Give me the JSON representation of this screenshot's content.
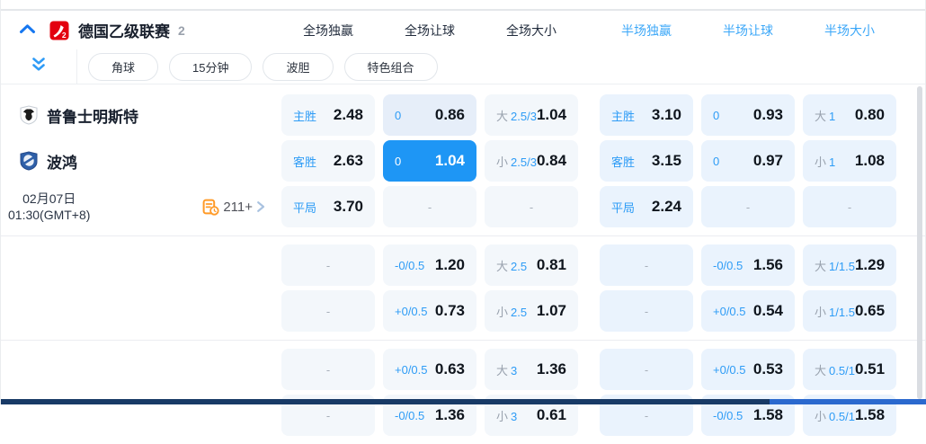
{
  "header": {
    "league_name": "德国乙级联赛",
    "league_count": "2",
    "league_logo_icon": "bundesliga2-logo-icon",
    "collapse_icon": "chevron-up-icon",
    "columns": [
      {
        "label": "全场独赢",
        "half": false
      },
      {
        "label": "全场让球",
        "half": false
      },
      {
        "label": "全场大小",
        "half": false
      },
      {
        "label": "半场独赢",
        "half": true
      },
      {
        "label": "半场让球",
        "half": true
      },
      {
        "label": "半场大小",
        "half": true
      }
    ]
  },
  "subnav": {
    "expand_icon": "double-chevron-down-icon",
    "pills": [
      {
        "label": "角球"
      },
      {
        "label": "15分钟"
      },
      {
        "label": "波胆"
      },
      {
        "label": "特色组合"
      }
    ]
  },
  "match": {
    "home": {
      "name": "普鲁士明斯特",
      "crest_icon": "muenster-eagle-crest-icon"
    },
    "away": {
      "name": "波鸿",
      "crest_icon": "bochum-crest-icon"
    },
    "date": "02月07日",
    "time": "01:30(GMT+8)",
    "more_markets_icon": "markets-clock-icon",
    "more_markets": "211+",
    "more_arrow_icon": "chevron-right-icon"
  },
  "colors": {
    "accent": "#2E9CF6",
    "half_header": "#3BA7F8",
    "selected_cell": "#1E96F5",
    "cell_bg_left": "#F3F7FB",
    "cell_bg_right": "#EAF3FD",
    "bottom_bar": "#183A66",
    "bottom_bar_segment": "#2B69CE",
    "more_icon_orange": "#FF9A27"
  },
  "odds": {
    "groups": [
      {
        "rows": [
          {
            "info": "home",
            "cells": [
              {
                "label": "主胜",
                "value": "2.48"
              },
              {
                "label": "0",
                "value": "0.86",
                "shaded": true
              },
              {
                "pre": "大",
                "label": "2.5/3",
                "value": "1.04"
              },
              {
                "label": "主胜",
                "value": "3.10"
              },
              {
                "label": "0",
                "value": "0.93"
              },
              {
                "pre": "大",
                "label": "1",
                "value": "0.80"
              }
            ]
          },
          {
            "info": "away",
            "cells": [
              {
                "label": "客胜",
                "value": "2.63"
              },
              {
                "label": "0",
                "value": "1.04",
                "selected": true
              },
              {
                "pre": "小",
                "label": "2.5/3",
                "value": "0.84"
              },
              {
                "label": "客胜",
                "value": "3.15"
              },
              {
                "label": "0",
                "value": "0.97"
              },
              {
                "pre": "小",
                "label": "1",
                "value": "1.08"
              }
            ]
          },
          {
            "info": "meta",
            "cells": [
              {
                "label": "平局",
                "value": "3.70"
              },
              {
                "dash": true
              },
              {
                "dash": true
              },
              {
                "label": "平局",
                "value": "2.24"
              },
              {
                "dash": true
              },
              {
                "dash": true
              }
            ]
          }
        ]
      },
      {
        "rows": [
          {
            "cells": [
              {
                "dash": true
              },
              {
                "label": "-0/0.5",
                "value": "1.20"
              },
              {
                "pre": "大",
                "label": "2.5",
                "value": "0.81"
              },
              {
                "dash": true
              },
              {
                "label": "-0/0.5",
                "value": "1.56"
              },
              {
                "pre": "大",
                "label": "1/1.5",
                "value": "1.29"
              }
            ]
          },
          {
            "cells": [
              {
                "dash": true
              },
              {
                "label": "+0/0.5",
                "value": "0.73"
              },
              {
                "pre": "小",
                "label": "2.5",
                "value": "1.07"
              },
              {
                "dash": true
              },
              {
                "label": "+0/0.5",
                "value": "0.54"
              },
              {
                "pre": "小",
                "label": "1/1.5",
                "value": "0.65"
              }
            ]
          }
        ]
      },
      {
        "rows": [
          {
            "cells": [
              {
                "dash": true
              },
              {
                "label": "+0/0.5",
                "value": "0.63"
              },
              {
                "pre": "大",
                "label": "3",
                "value": "1.36"
              },
              {
                "dash": true
              },
              {
                "label": "+0/0.5",
                "value": "0.53"
              },
              {
                "pre": "大",
                "label": "0.5/1",
                "value": "0.51"
              }
            ]
          },
          {
            "cells": [
              {
                "dash": true
              },
              {
                "label": "-0/0.5",
                "value": "1.36"
              },
              {
                "pre": "小",
                "label": "3",
                "value": "0.61"
              },
              {
                "dash": true
              },
              {
                "label": "-0/0.5",
                "value": "1.58"
              },
              {
                "pre": "小",
                "label": "0.5/1",
                "value": "1.58"
              }
            ]
          }
        ]
      }
    ]
  }
}
